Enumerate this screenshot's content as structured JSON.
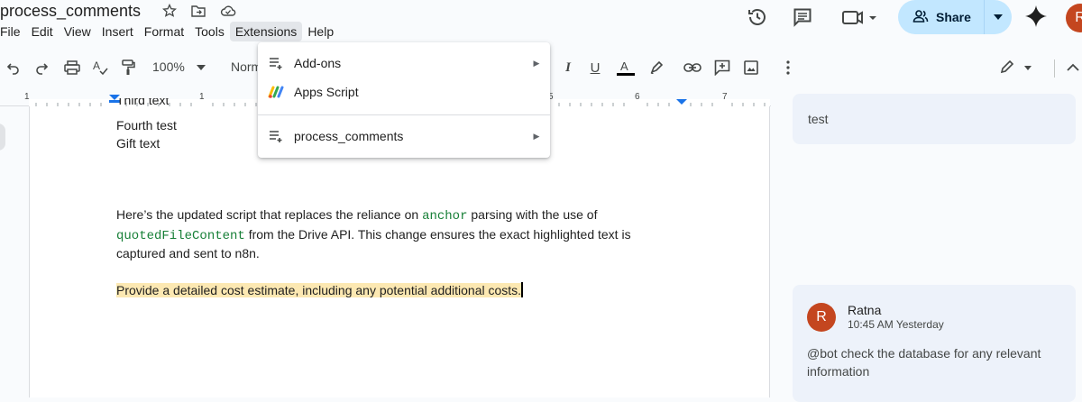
{
  "doc": {
    "title": "process_comments"
  },
  "menu": {
    "items": [
      "File",
      "Edit",
      "View",
      "Insert",
      "Format",
      "Tools",
      "Extensions",
      "Help"
    ]
  },
  "share": {
    "label": "Share"
  },
  "user": {
    "initial": "R"
  },
  "toolbar": {
    "zoom": "100%",
    "style": "Norm"
  },
  "ruler": {
    "numbers": [
      "1",
      "1",
      "5",
      "6",
      "7"
    ]
  },
  "extensions_menu": {
    "items": [
      {
        "label": "Add-ons",
        "icon": "addons-icon",
        "has_submenu": true
      },
      {
        "label": "Apps Script",
        "icon": "apps-script-icon",
        "has_submenu": false
      },
      {
        "label": "process_comments",
        "icon": "addon-list-icon",
        "has_submenu": true
      }
    ]
  },
  "document": {
    "line_partial": "Third text",
    "line_fourth": "Fourth test",
    "line_gift": "Gift text",
    "para1_a": "Here’s the updated script that replaces the reliance on ",
    "para1_code1": "anchor",
    "para1_b": " parsing with the use of",
    "para1_code2": "quotedFileContent",
    "para1_c": " from the Drive API. This change ensures the exact highlighted text is",
    "para1_d": "captured and sent to n8n.",
    "highlighted": "Provide a detailed cost estimate, including any potential additional costs."
  },
  "comments": [
    {
      "text": "test"
    },
    {
      "author": "Ratna",
      "initial": "R",
      "time": "10:45 AM Yesterday",
      "text": "@bot check the database for any relevant information"
    }
  ],
  "colors": {
    "accent": "#c2e7ff",
    "avatar": "#c4461f",
    "highlight": "#fce8b2",
    "code": "#188038"
  }
}
